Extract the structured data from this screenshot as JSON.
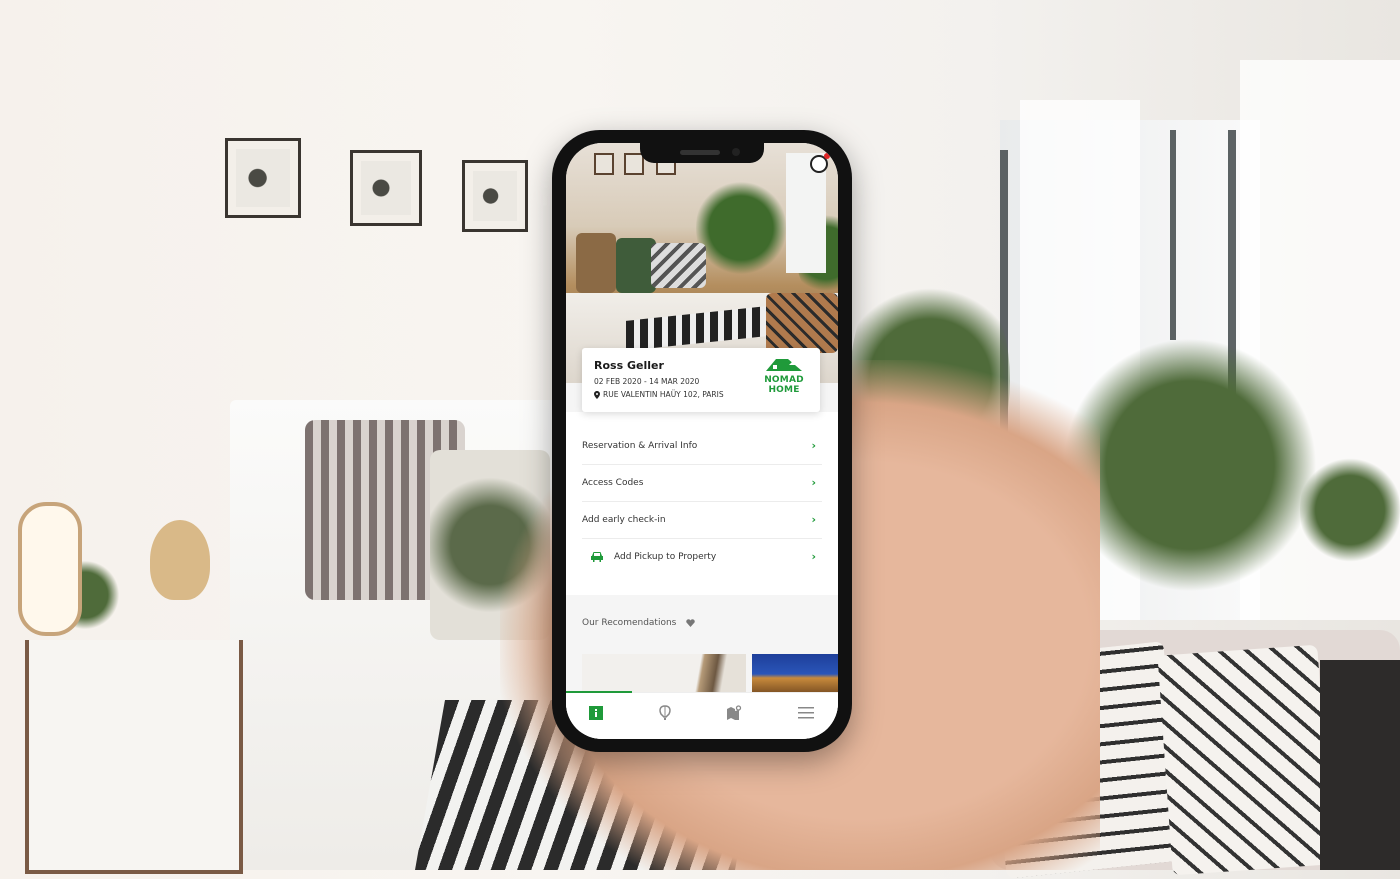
{
  "background": {
    "scene": "bedroom-interior-photo",
    "hand": "hand-holding-phone"
  },
  "app": {
    "brand": {
      "line1": "NOMAD",
      "line2": "HOME",
      "color": "#1f9a3a"
    },
    "accent_color": "#1f9a3a",
    "guest": {
      "name": "Ross Geller",
      "dates": "02 FEB 2020 - 14 MAR 2020",
      "address": "RUE VALENTIN HAÜY 102, PARIS"
    },
    "menu": [
      {
        "label": "Reservation & Arrival Info",
        "icon": null
      },
      {
        "label": "Access Codes",
        "icon": null
      },
      {
        "label": "Add early check-in",
        "icon": null
      },
      {
        "label": "Add Pickup to Property",
        "icon": "car-icon"
      }
    ],
    "recommendations": {
      "title": "Our Recomendations",
      "icon": "heart-icon",
      "items": [
        "building-photo",
        "notre-dame-photo"
      ]
    },
    "tabbar": [
      {
        "name": "info",
        "icon": "info-icon",
        "active": true
      },
      {
        "name": "balloon",
        "icon": "hot-air-balloon-icon",
        "active": false
      },
      {
        "name": "map",
        "icon": "map-pin-icon",
        "active": false
      },
      {
        "name": "menu",
        "icon": "hamburger-menu-icon",
        "active": false
      }
    ]
  }
}
